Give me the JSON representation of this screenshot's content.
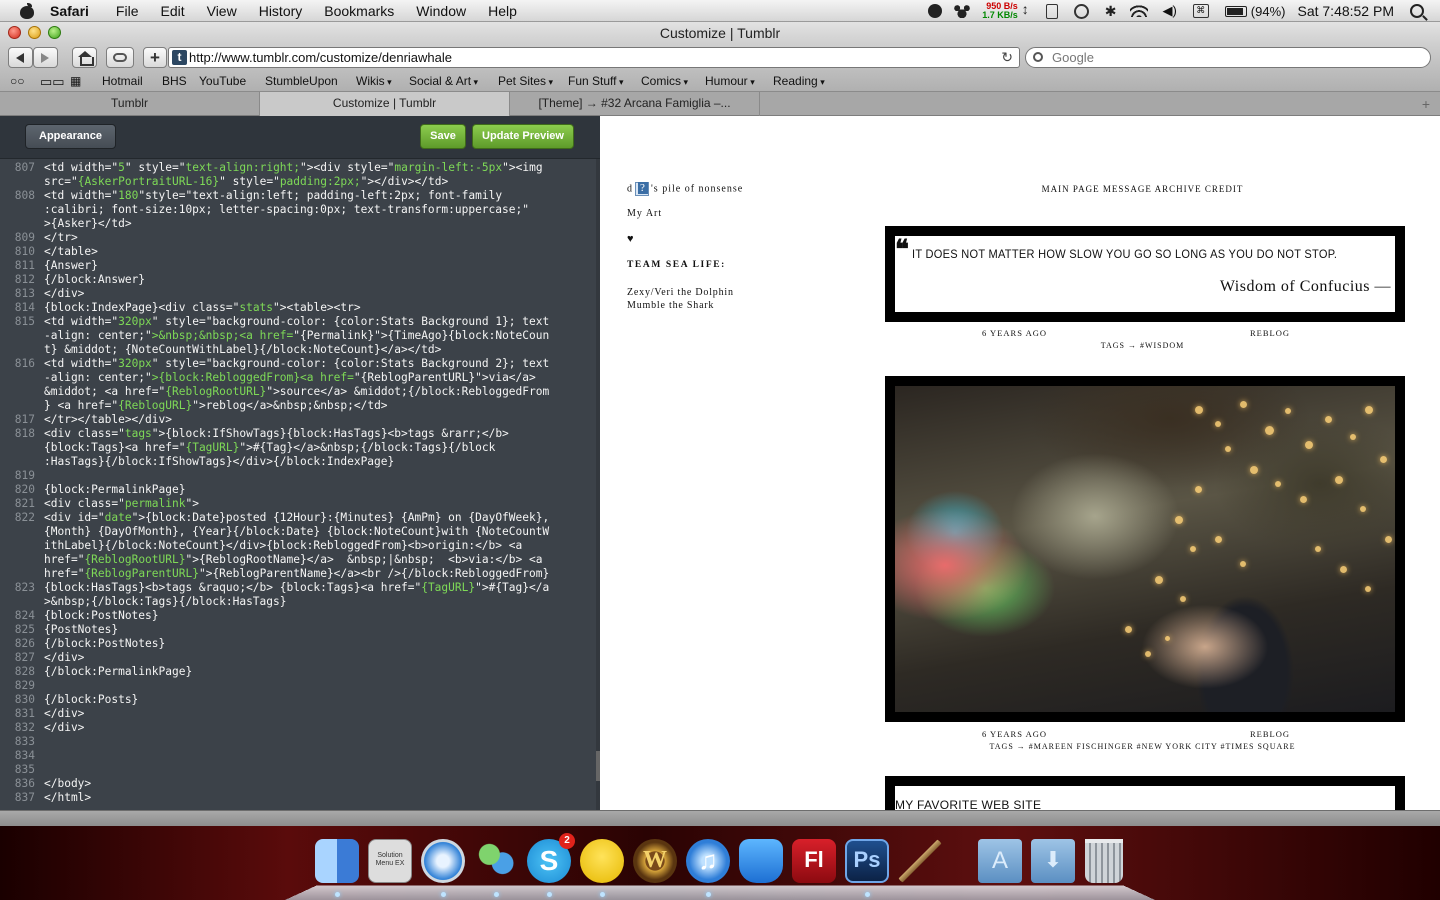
{
  "menubar": {
    "app": "Safari",
    "items": [
      "File",
      "Edit",
      "View",
      "History",
      "Bookmarks",
      "Window",
      "Help"
    ],
    "net_up": "950 B/s",
    "net_down": "1.7 KB/s",
    "battery": "(94%)",
    "clock": "Sat 7:48:52 PM"
  },
  "window": {
    "title": "Customize | Tumblr"
  },
  "toolbar": {
    "url": "http://www.tumblr.com/customize/denriawhale",
    "search_placeholder": "Google"
  },
  "bookmarks": [
    "Hotmail",
    "BHS",
    "YouTube",
    "StumbleUpon",
    "Wikis",
    "Social & Art",
    "Pet Sites",
    "Fun Stuff",
    "Comics",
    "Humour",
    "Reading"
  ],
  "tabs": [
    "Tumblr",
    "Customize | Tumblr",
    "[Theme] → #32 Arcana Famiglia –..."
  ],
  "editor": {
    "appearance_label": "Appearance",
    "save_label": "Save",
    "update_label": "Update Preview"
  },
  "code_lines": [
    {
      "n": "807",
      "t": "<td width=\"5\" style=\"text-align:right;\"><div style=\"margin-left:-5px\"><img"
    },
    {
      "n": "",
      "t": "src=\"{AskerPortraitURL-16}\" style=\"padding:2px;\"></div></td>"
    },
    {
      "n": "808",
      "t": "<td width=\"180\"style=\"text-align:left; padding-left:2px; font-family"
    },
    {
      "n": "",
      "t": ":calibri; font-size:10px; letter-spacing:0px; text-transform:uppercase;\""
    },
    {
      "n": "",
      "t": ">{Asker}</td>"
    },
    {
      "n": "809",
      "t": "</tr>"
    },
    {
      "n": "810",
      "t": "</table>"
    },
    {
      "n": "811",
      "t": "{Answer}"
    },
    {
      "n": "812",
      "t": "{/block:Answer}"
    },
    {
      "n": "813",
      "t": "</div>"
    },
    {
      "n": "814",
      "t": "{block:IndexPage}<div class=\"stats\"><table><tr>"
    },
    {
      "n": "815",
      "t": "<td width=\"320px\" style=\"background-color: {color:Stats Background 1}; text"
    },
    {
      "n": "",
      "t": "-align: center;\">&nbsp;&nbsp;<a href=\"{Permalink}\">{TimeAgo}{block:NoteCoun"
    },
    {
      "n": "",
      "t": "t} &middot; {NoteCountWithLabel}{/block:NoteCount}</a></td>"
    },
    {
      "n": "816",
      "t": "<td width=\"320px\" style=\"background-color: {color:Stats Background 2}; text"
    },
    {
      "n": "",
      "t": "-align: center;\">{block:RebloggedFrom}<a href=\"{ReblogParentURL}\">via</a>"
    },
    {
      "n": "",
      "t": "&middot; <a href=\"{ReblogRootURL}\">source</a> &middot;{/block:RebloggedFrom"
    },
    {
      "n": "",
      "t": "} <a href=\"{ReblogURL}\">reblog</a>&nbsp;&nbsp;</td>"
    },
    {
      "n": "817",
      "t": "</tr></table></div>"
    },
    {
      "n": "818",
      "t": "<div class=\"tags\">{block:IfShowTags}{block:HasTags}<b>tags &rarr;</b>"
    },
    {
      "n": "",
      "t": "{block:Tags}<a href=\"{TagURL}\">#{Tag}</a>&nbsp;{/block:Tags}{/block"
    },
    {
      "n": "",
      "t": ":HasTags}{/block:IfShowTags}</div>{/block:IndexPage}"
    },
    {
      "n": "819",
      "t": ""
    },
    {
      "n": "820",
      "t": "{block:PermalinkPage}"
    },
    {
      "n": "821",
      "t": "<div class=\"permalink\">"
    },
    {
      "n": "822",
      "t": "<div id=\"date\">{block:Date}posted {12Hour}:{Minutes} {AmPm} on {DayOfWeek},"
    },
    {
      "n": "",
      "t": "{Month} {DayOfMonth}, {Year}{/block:Date} {block:NoteCount}with {NoteCountW"
    },
    {
      "n": "",
      "t": "ithLabel}{/block:NoteCount}</div>{block:RebloggedFrom}<b>origin:</b> <a"
    },
    {
      "n": "",
      "t": "href=\"{ReblogRootURL}\">{ReblogRootName}</a>  &nbsp;|&nbsp;  <b>via:</b> <a"
    },
    {
      "n": "",
      "t": "href=\"{ReblogParentURL}\">{ReblogParentName}</a><br />{/block:RebloggedFrom}"
    },
    {
      "n": "823",
      "t": "{block:HasTags}<b>tags &raquo;</b> {block:Tags}<a href=\"{TagURL}\">#{Tag}</a"
    },
    {
      "n": "",
      "t": ">&nbsp;{/block:Tags}{/block:HasTags}"
    },
    {
      "n": "824",
      "t": "{block:PostNotes}"
    },
    {
      "n": "825",
      "t": "{PostNotes}"
    },
    {
      "n": "826",
      "t": "{/block:PostNotes}"
    },
    {
      "n": "827",
      "t": "</div>"
    },
    {
      "n": "828",
      "t": "{/block:PermalinkPage}"
    },
    {
      "n": "829",
      "t": ""
    },
    {
      "n": "830",
      "t": "{/block:Posts}"
    },
    {
      "n": "831",
      "t": "</div>"
    },
    {
      "n": "832",
      "t": "</div>"
    },
    {
      "n": "833",
      "t": ""
    },
    {
      "n": "834",
      "t": ""
    },
    {
      "n": "835",
      "t": ""
    },
    {
      "n": "836",
      "t": "</body>"
    },
    {
      "n": "837",
      "t": "</html>"
    }
  ],
  "preview": {
    "blog_title_pre": "d",
    "blog_title_post": "'s pile of nonsense",
    "my_art": "My Art",
    "heart": "♥",
    "team_heading": "TEAM SEA LIFE:",
    "team_members": [
      "Zexy/Veri the Dolphin",
      "Mumble the Shark"
    ],
    "nav": "MAIN PAGE MESSAGE ARCHIVE CREDIT",
    "quote_mark": "❝",
    "quote_text": "IT DOES NOT MATTER HOW SLOW YOU GO SO LONG AS YOU DO NOT STOP.",
    "quote_source": "Wisdom of Confucius —",
    "post1_time": "6 YEARS AGO",
    "post1_reblog": "REBLOG",
    "post1_tags": "TAGS → #WISDOM",
    "post2_time": "6 YEARS AGO",
    "post2_reblog": "REBLOG",
    "post2_tags": "TAGS → #MAREEN FISCHINGER #NEW YORK CITY #TIMES SQUARE",
    "post3_title": "MY FAVORITE WEB SITE"
  },
  "dock": {
    "apps": [
      "finder-icon",
      "solution-menu-icon",
      "safari-icon",
      "messenger-icon",
      "skype-icon",
      "adium-icon",
      "warcraft-icon",
      "itunes-icon",
      "wacom-icon",
      "flash-icon",
      "photoshop-icon",
      "paintbrush-icon",
      "applications-folder-icon",
      "downloads-folder-icon",
      "trash-icon"
    ],
    "solution_label": "Solution Menu EX",
    "skype_badge": "2",
    "flash_label": "Fl",
    "photoshop_label": "Ps"
  },
  "colors": {
    "editor_bg": "#3c4249",
    "code_string": "#7ed957",
    "button_green": "#6aa834",
    "preview_frame": "#000000"
  }
}
